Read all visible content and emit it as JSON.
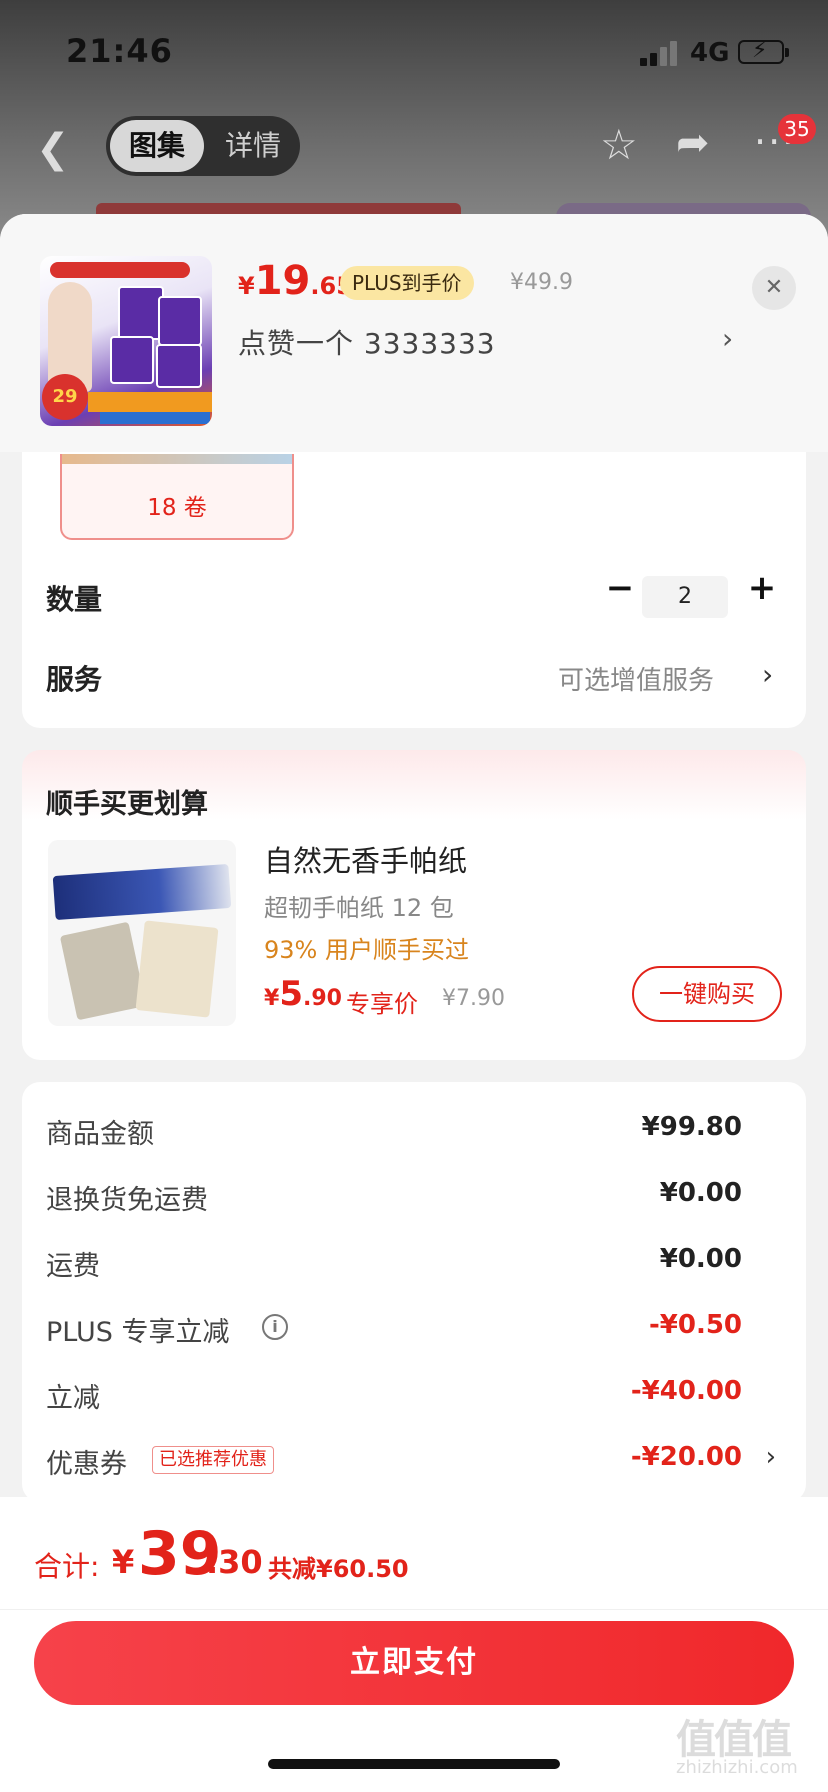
{
  "status": {
    "time": "21:46",
    "network": "4G"
  },
  "nav": {
    "tab_active": "图集",
    "tab_inactive": "详情",
    "badge": "35"
  },
  "product": {
    "price_symbol": "¥",
    "price_int": "19",
    "price_dec": ".65",
    "plus_tag": "PLUS到手价",
    "original_price": "¥49.9",
    "spec": "点赞一个  3333333",
    "spec_option": "18 卷"
  },
  "quantity": {
    "label": "数量",
    "value": "2"
  },
  "service": {
    "label": "服务",
    "value": "可选增值服务"
  },
  "bundle": {
    "title": "顺手买更划算",
    "name": "自然无香手帕纸",
    "subtitle": "超韧手帕纸 12 包",
    "percent": "93% 用户顺手买过",
    "price_symbol": "¥",
    "price_int": "5",
    "price_dec": ".90",
    "price_tag": "专享价",
    "original_price": "¥7.90",
    "buy_label": "一键购买"
  },
  "summary": {
    "rows": [
      {
        "label": "商品金额",
        "value": "¥99.80"
      },
      {
        "label": "退换货免运费",
        "value": "¥0.00"
      },
      {
        "label": "运费",
        "value": "¥0.00"
      },
      {
        "label": "PLUS 专享立减",
        "value": "-¥0.50"
      },
      {
        "label": "立减",
        "value": "-¥40.00"
      },
      {
        "label": "优惠券",
        "value": "-¥20.00",
        "tag": "已选推荐优惠"
      }
    ]
  },
  "total": {
    "label": "合计:",
    "symbol": "¥",
    "int": "39",
    "dec": ".30",
    "saving": "共减¥60.50"
  },
  "pay_button": "立即支付",
  "watermark": {
    "logo": "值值值",
    "url": "zhizhizhi.com"
  },
  "colors": {
    "accent_red": "#e2231a",
    "plus_gold": "#fbe6a2",
    "percent_orange": "#d8841d"
  },
  "icons": [
    "back-icon",
    "star-icon",
    "share-icon",
    "more-icon",
    "close-icon",
    "chevron-right-icon",
    "minus-icon",
    "plus-icon",
    "info-icon"
  ]
}
